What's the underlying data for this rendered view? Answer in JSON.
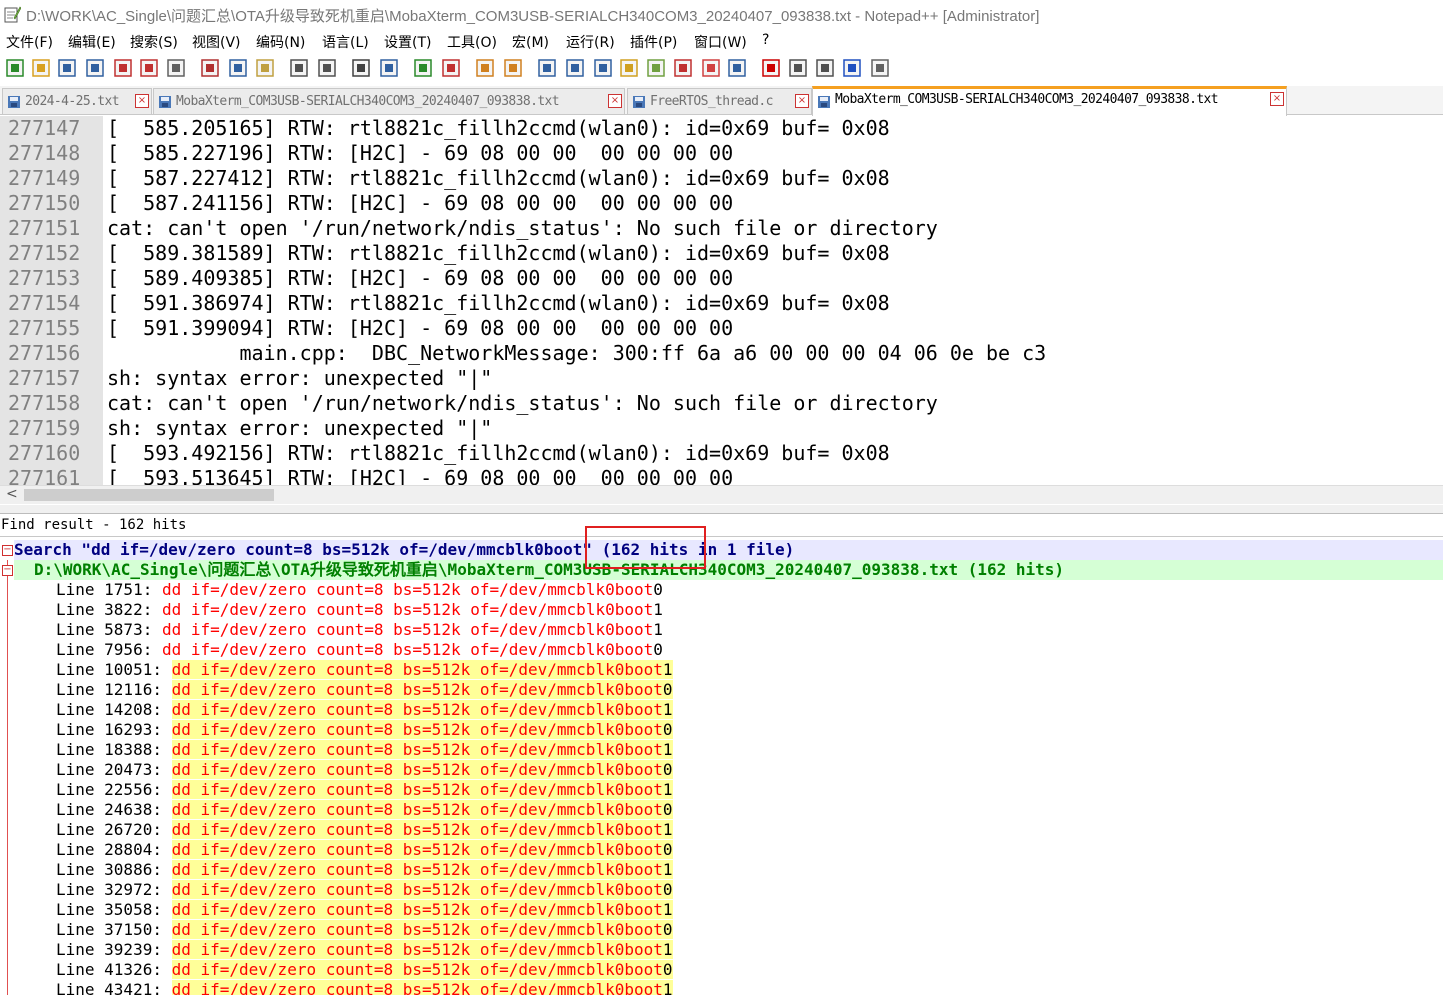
{
  "window": {
    "title": "D:\\WORK\\AC_Single\\问题汇总\\OTA升级导致死机重启\\MobaXterm_COM3USB-SERIALCH340COM3_20240407_093838.txt - Notepad++ [Administrator]",
    "app_icon": "notepad-icon"
  },
  "menu": [
    "文件(F)",
    "编辑(E)",
    "搜索(S)",
    "视图(V)",
    "编码(N)",
    "语言(L)",
    "设置(T)",
    "工具(O)",
    "宏(M)",
    "运行(R)",
    "插件(P)",
    "窗口(W)",
    "?"
  ],
  "toolbar_icons": [
    "new-file-icon",
    "open-file-icon",
    "save-icon",
    "save-all-icon",
    "close-icon",
    "close-all-icon",
    "print-icon",
    "cut-icon",
    "copy-icon",
    "paste-icon",
    "undo-icon",
    "redo-icon",
    "find-icon",
    "replace-icon",
    "zoom-in-icon",
    "zoom-out-icon",
    "sync-vertical-icon",
    "sync-horizontal-icon",
    "word-wrap-icon",
    "show-all-chars-icon",
    "indent-guide-icon",
    "user-language-icon",
    "doc-map-icon",
    "function-list-icon",
    "folder-workspace-icon",
    "monitoring-icon",
    "macro-record-icon",
    "macro-stop-icon",
    "macro-play-icon",
    "macro-run-multiple-icon",
    "macro-save-icon"
  ],
  "tabs": [
    {
      "label": "2024-4-25.txt",
      "active": false
    },
    {
      "label": "MobaXterm_COM3USB-SERIALCH340COM3_20240407_093838.txt",
      "active": false
    },
    {
      "label": "FreeRTOS_thread.c",
      "active": false
    },
    {
      "label": "MobaXterm_COM3USB-SERIALCH340COM3_20240407_093838.txt",
      "active": true
    }
  ],
  "editor_lines": [
    {
      "num": "277147",
      "text": "[  585.205165] RTW: rtl8821c_fillh2ccmd(wlan0): id=0x69 buf= 0x08"
    },
    {
      "num": "277148",
      "text": "[  585.227196] RTW: [H2C] - 69 08 00 00  00 00 00 00"
    },
    {
      "num": "277149",
      "text": "[  587.227412] RTW: rtl8821c_fillh2ccmd(wlan0): id=0x69 buf= 0x08"
    },
    {
      "num": "277150",
      "text": "[  587.241156] RTW: [H2C] - 69 08 00 00  00 00 00 00"
    },
    {
      "num": "277151",
      "text": "cat: can't open '/run/network/ndis_status': No such file or directory"
    },
    {
      "num": "277152",
      "text": "[  589.381589] RTW: rtl8821c_fillh2ccmd(wlan0): id=0x69 buf= 0x08"
    },
    {
      "num": "277153",
      "text": "[  589.409385] RTW: [H2C] - 69 08 00 00  00 00 00 00"
    },
    {
      "num": "277154",
      "text": "[  591.386974] RTW: rtl8821c_fillh2ccmd(wlan0): id=0x69 buf= 0x08"
    },
    {
      "num": "277155",
      "text": "[  591.399094] RTW: [H2C] - 69 08 00 00  00 00 00 00"
    },
    {
      "num": "277156",
      "text": "           main.cpp:  DBC_NetworkMessage: 300:ff 6a a6 00 00 00 04 06 0e be c3"
    },
    {
      "num": "277157",
      "text": "sh: syntax error: unexpected \"|\""
    },
    {
      "num": "277158",
      "text": "cat: can't open '/run/network/ndis_status': No such file or directory"
    },
    {
      "num": "277159",
      "text": "sh: syntax error: unexpected \"|\""
    },
    {
      "num": "277160",
      "text": "[  593.492156] RTW: rtl8821c_fillh2ccmd(wlan0): id=0x69 buf= 0x08"
    },
    {
      "num": "277161",
      "text": "[  593.513645] RTW: [H2C] - 69 08 00 00  00 00 00 00"
    }
  ],
  "find_result": {
    "header": "Find result - 162 hits",
    "search_line": "Search \"dd if=/dev/zero count=8 bs=512k of=/dev/mmcblk0boot\" (162 hits in 1 file)",
    "file_line": "D:\\WORK\\AC_Single\\问题汇总\\OTA升级导致死机重启\\MobaXterm_COM3USB-SERIALCH340COM3_20240407_093838.txt (162 hits)",
    "match_text": "dd if=/dev/zero count=8 bs=512k of=/dev/mmcblk0boot",
    "hits": [
      {
        "line": "Line 1751: ",
        "end": "0",
        "highlighted": false
      },
      {
        "line": "Line 3822: ",
        "end": "1",
        "highlighted": false
      },
      {
        "line": "Line 5873: ",
        "end": "1",
        "highlighted": false
      },
      {
        "line": "Line 7956: ",
        "end": "0",
        "highlighted": false
      },
      {
        "line": "Line 10051: ",
        "end": "1",
        "highlighted": true
      },
      {
        "line": "Line 12116: ",
        "end": "0",
        "highlighted": true
      },
      {
        "line": "Line 14208: ",
        "end": "1",
        "highlighted": true
      },
      {
        "line": "Line 16293: ",
        "end": "0",
        "highlighted": true
      },
      {
        "line": "Line 18388: ",
        "end": "1",
        "highlighted": true
      },
      {
        "line": "Line 20473: ",
        "end": "0",
        "highlighted": true
      },
      {
        "line": "Line 22556: ",
        "end": "1",
        "highlighted": true
      },
      {
        "line": "Line 24638: ",
        "end": "0",
        "highlighted": true
      },
      {
        "line": "Line 26720: ",
        "end": "1",
        "highlighted": true
      },
      {
        "line": "Line 28804: ",
        "end": "0",
        "highlighted": true
      },
      {
        "line": "Line 30886: ",
        "end": "1",
        "highlighted": true
      },
      {
        "line": "Line 32972: ",
        "end": "0",
        "highlighted": true
      },
      {
        "line": "Line 35058: ",
        "end": "1",
        "highlighted": true
      },
      {
        "line": "Line 37150: ",
        "end": "0",
        "highlighted": true
      },
      {
        "line": "Line 39239: ",
        "end": "1",
        "highlighted": true
      },
      {
        "line": "Line 41326: ",
        "end": "0",
        "highlighted": true
      },
      {
        "line": "Line 43421: ",
        "end": "1",
        "highlighted": true
      }
    ]
  },
  "colors": {
    "accent_tab": "#f5a020",
    "search_bg": "#e8e8ff",
    "file_bg": "#d5ffd5",
    "match_fg": "#ff0000",
    "match_bg": "#ffff99",
    "annotation": "#e02020"
  }
}
